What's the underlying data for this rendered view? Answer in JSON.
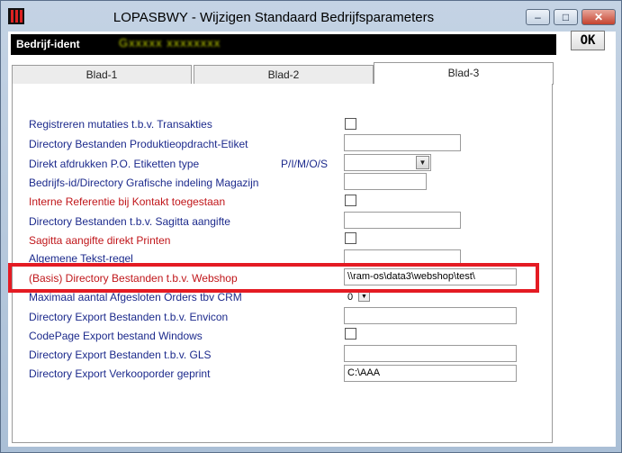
{
  "window": {
    "title": "LOPASBWY - Wijzigen Standaard Bedrijfsparameters"
  },
  "ident": {
    "label": "Bedrijf-ident",
    "value": "Gxxxxx  xxxxxxxx"
  },
  "tabs": [
    {
      "label": "Blad-1"
    },
    {
      "label": "Blad-2"
    },
    {
      "label": "Blad-3"
    }
  ],
  "ok_label": "OK",
  "rows": [
    {
      "label": "Registreren mutaties t.b.v. Transakties"
    },
    {
      "label": "Directory Bestanden Produktieopdracht-Etiket",
      "value": ""
    },
    {
      "label": "Direkt afdrukken P.O. Etiketten type",
      "sublabel": "P/I/M/O/S",
      "value": ""
    },
    {
      "label": "Bedrijfs-id/Directory Grafische indeling Magazijn",
      "value": ""
    },
    {
      "label": "Interne Referentie bij Kontakt toegestaan"
    },
    {
      "label": "Directory Bestanden t.b.v. Sagitta aangifte",
      "value": ""
    },
    {
      "label": "Sagitta aangifte direkt Printen"
    },
    {
      "label": "Algemene Tekst-regel",
      "value": ""
    },
    {
      "label": "(Basis) Directory Bestanden t.b.v. Webshop",
      "value": "\\\\ram-os\\data3\\webshop\\test\\"
    },
    {
      "label": "Maximaal aantal Afgesloten Orders tbv CRM",
      "value": "0"
    },
    {
      "label": "Directory Export Bestanden t.b.v. Envicon",
      "value": ""
    },
    {
      "label": "CodePage Export bestand Windows"
    },
    {
      "label": "Directory Export Bestanden t.b.v. GLS",
      "value": ""
    },
    {
      "label": "Directory Export Verkooporder geprint",
      "value": "C:\\AAA"
    }
  ],
  "colors": {
    "label_blue": "#1c2a8c",
    "label_red": "#c0161a",
    "highlight": "#e41b23"
  }
}
